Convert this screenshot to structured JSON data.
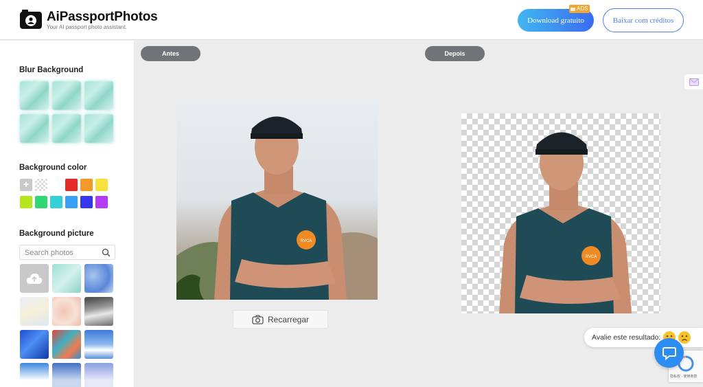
{
  "header": {
    "app_name": "AiPassportPhotos",
    "tagline": "Your AI passport photo assistant.",
    "download_button": "Download gratuito",
    "ads_badge": "ADS",
    "credits_button": "Baixar com créditos"
  },
  "sidebar": {
    "blur_title": "Blur Background",
    "color_title": "Background color",
    "colors": [
      "#e52a2a",
      "#f7982a",
      "#f5e23a",
      "#b5e61d",
      "#2fd873",
      "#35cfd8",
      "#3aa0f5",
      "#3636f0",
      "#b43af5"
    ],
    "picture_title": "Background picture",
    "search_placeholder": "Search photos"
  },
  "main": {
    "before_label": "Antes",
    "after_label": "Depois",
    "reload_button": "Recarregar"
  },
  "overlay": {
    "rating_text": "Avalie este resultado:",
    "recaptcha_text": "隐私权 - 使用条款"
  },
  "colors": {
    "accent": "#3a6cf0",
    "pill": "#707378",
    "chat": "#2c8cf4"
  }
}
